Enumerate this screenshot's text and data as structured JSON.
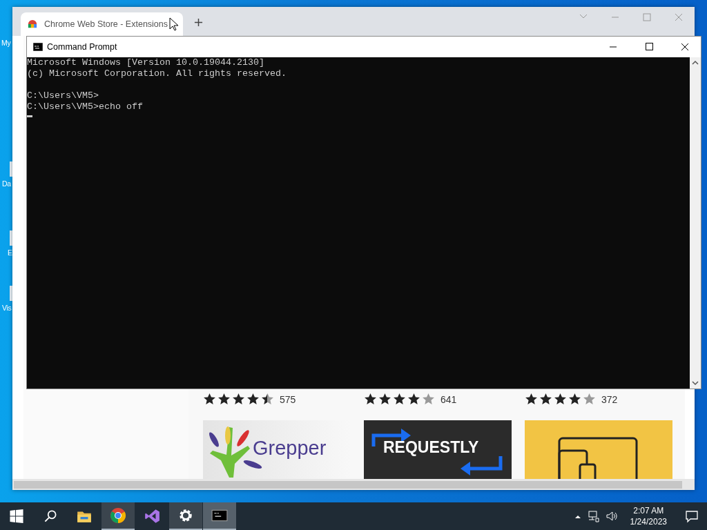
{
  "desktop_icons": [
    {
      "label": "My"
    },
    {
      "label": "Da"
    },
    {
      "label": "E"
    },
    {
      "label": "Vis"
    }
  ],
  "browser": {
    "tabs": [
      {
        "label": "Chrome Web Store - Extensions",
        "selected": true
      }
    ],
    "extensions": [
      {
        "stars": 4.5,
        "count": "575",
        "thumbnail": {
          "kind": "grepper",
          "text": "Grepper"
        }
      },
      {
        "stars": 4,
        "count": "641",
        "thumbnail": {
          "kind": "requestly",
          "text": "REQUESTLY"
        }
      },
      {
        "stars": 4,
        "count": "372",
        "thumbnail": {
          "kind": "devices"
        }
      }
    ]
  },
  "console": {
    "title": "Command Prompt",
    "blocks": [
      [
        "Microsoft Windows [Version 10.0.19044.2130]",
        "(c) Microsoft Corporation. All rights reserved."
      ],
      [
        "C:\\Users\\VM5>",
        "C:\\Users\\VM5>echo off"
      ]
    ]
  },
  "taskbar": {
    "apps": [
      {
        "kind": "search",
        "running": false,
        "selected": false
      },
      {
        "kind": "explorer",
        "running": false,
        "selected": false
      },
      {
        "kind": "chrome",
        "running": true,
        "selected": false
      },
      {
        "kind": "studio",
        "running": false,
        "selected": false
      },
      {
        "kind": "settings",
        "running": true,
        "selected": false
      },
      {
        "kind": "console",
        "running": true,
        "selected": true
      }
    ],
    "clock": {
      "time": "2:07 AM",
      "date": "1/24/2023"
    }
  }
}
